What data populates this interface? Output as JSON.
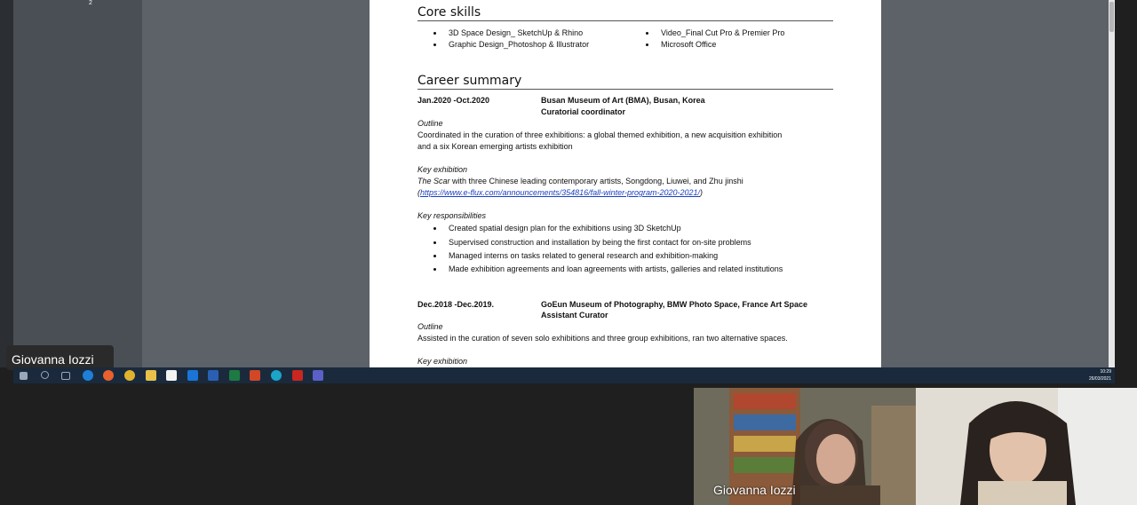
{
  "thumbnail_page_number": "2",
  "presenter_name": "Giovanna Iozzi",
  "document": {
    "core_skills_heading": "Core skills",
    "skills": [
      "3D Space Design_ SketchUp & Rhino",
      "Graphic Design_Photoshop & Illustrator",
      "Video_Final Cut Pro & Premier Pro",
      "Microsoft Office"
    ],
    "career_heading": "Career summary",
    "job1": {
      "dates": "Jan.2020 -Oct.2020",
      "org": "Busan Museum of Art (BMA), Busan, Korea",
      "role": "Curatorial coordinator",
      "outline_label": "Outline",
      "outline_line1": "Coordinated in the curation of three exhibitions: a global themed exhibition, a new acquisition exhibition",
      "outline_line2": "and a six Korean emerging artists exhibition",
      "key_exhibition_label": "Key exhibition",
      "exhibition_title": "The Scar",
      "exhibition_text": " with three Chinese leading contemporary artists, Songdong, Liuwei, and Zhu jinshi",
      "link_open": "(",
      "link": "https://www.e-flux.com/announcements/354816/fall-winter-program-2020-2021/",
      "link_close": ")",
      "responsibilities_label": "Key responsibilities",
      "responsibilities": [
        "Created spatial design plan for the exhibitions using 3D SketchUp",
        "Supervised construction and installation by being the first contact for on-site problems",
        "Managed interns on tasks related to general research and exhibition-making",
        "Made exhibition agreements and loan agreements with artists, galleries and related institutions"
      ]
    },
    "job2": {
      "dates": "Dec.2018 -Dec.2019.",
      "org": "GoEun Museum of Photography, BMW Photo Space, France Art Space",
      "role": "Assistant Curator",
      "outline_label": "Outline",
      "outline_line1": "Assisted in the curation of seven solo exhibitions and three group exhibitions, ran two alternative spaces.",
      "key_exhibition_label": "Key exhibition"
    }
  },
  "taskbar": {
    "time": "10:29",
    "date": "26/03/2021",
    "icons": [
      "windows-start-icon",
      "search-icon",
      "task-view-icon",
      "edge-icon",
      "firefox-icon",
      "chrome-icon",
      "file-explorer-icon",
      "store-icon",
      "mail-icon",
      "word-icon",
      "excel-icon",
      "powerpoint-icon",
      "edge-new-icon",
      "acrobat-icon",
      "teams-icon"
    ]
  },
  "participants": [
    {
      "name": "Giovanna Iozzi"
    },
    {
      "name": ""
    }
  ]
}
